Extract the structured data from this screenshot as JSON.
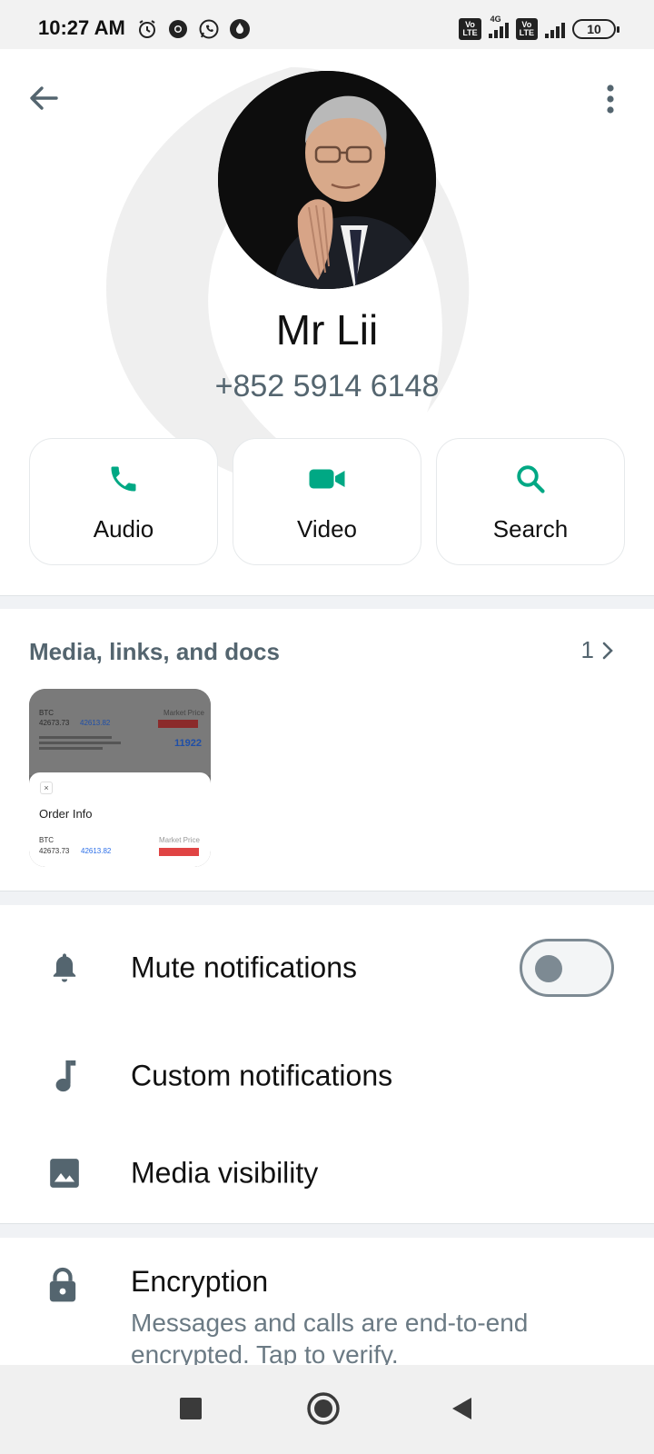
{
  "status_bar": {
    "time": "10:27 AM",
    "network_label": "4G",
    "volte_label": "Vo LTE",
    "battery": "10"
  },
  "contact": {
    "name": "Mr Lii",
    "phone": "+852 5914 6148"
  },
  "actions": [
    {
      "label": "Audio",
      "icon": "phone-icon"
    },
    {
      "label": "Video",
      "icon": "video-camera-icon"
    },
    {
      "label": "Search",
      "icon": "search-icon"
    }
  ],
  "media": {
    "title": "Media, links, and docs",
    "count": "1",
    "thumbnail": {
      "coin": "BTC",
      "price_from": "42673.73",
      "price_to": "42613.82",
      "top_right_label": "Market Price",
      "highlight_value": "11922",
      "sheet_title": "Order Info",
      "market_price_label": "Market Price"
    }
  },
  "settings": {
    "mute": "Mute notifications",
    "custom": "Custom notifications",
    "visibility": "Media visibility"
  },
  "encryption": {
    "title": "Encryption",
    "subtitle": "Messages and calls are end-to-end encrypted. Tap to verify."
  },
  "colors": {
    "accent_green": "#00a884",
    "icon_gray": "#54656f",
    "text_muted": "#6b7a84"
  }
}
